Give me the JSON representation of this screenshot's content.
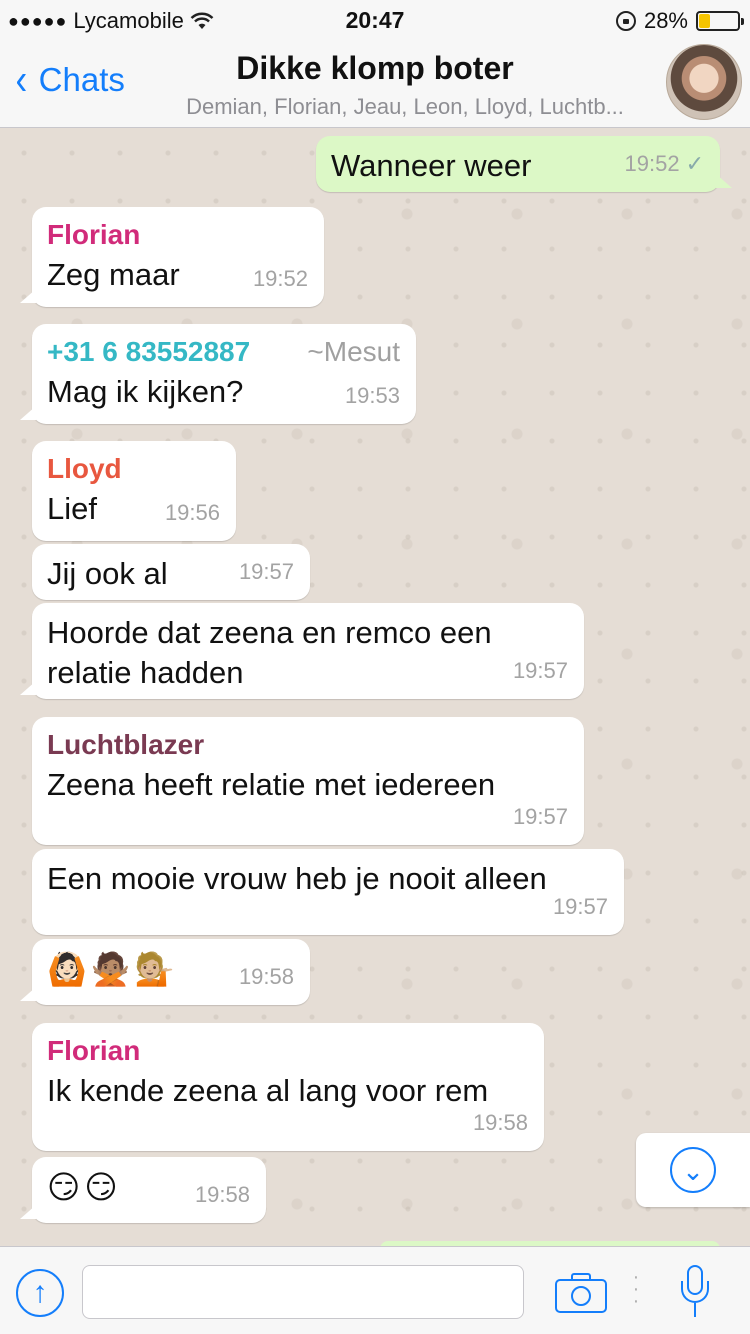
{
  "status_bar": {
    "carrier": "Lycamobile",
    "signal_dots": "●●●●●",
    "wifi": "wifi-icon",
    "time": "20:47",
    "battery_text": "28%",
    "battery_level": 0.28
  },
  "header": {
    "back_label": "Chats",
    "title": "Dikke klomp boter",
    "subtitle": "Demian, Florian, Jeau, Leon, Lloyd, Luchtb..."
  },
  "colors": {
    "accent": "#147efb",
    "outgoing_bubble": "#dcf8c6",
    "florian": "#d12b7a",
    "lloyd": "#e8573f",
    "luchtblazer": "#7a3a52",
    "phone": "#35b8c5"
  },
  "messages": [
    {
      "id": "m1",
      "text": "Wanneer weer",
      "time": "19:52",
      "status": "✓",
      "direction": "out"
    },
    {
      "id": "m2",
      "sender": "Florian",
      "text": "Zeg maar",
      "time": "19:52"
    },
    {
      "id": "m3",
      "phone": "+31 6 83552887",
      "alias": "~Mesut",
      "text": "Mag ik kijken?",
      "time": "19:53"
    },
    {
      "id": "m4",
      "sender": "Lloyd",
      "text": "Lief",
      "time": "19:56"
    },
    {
      "id": "m5",
      "text": "Jij ook al",
      "time": "19:57"
    },
    {
      "id": "m6",
      "text": "Hoorde dat zeena en remco een relatie hadden",
      "time": "19:57"
    },
    {
      "id": "m7",
      "sender": "Luchtblazer",
      "text": "Zeena heeft relatie met iedereen",
      "time": "19:57"
    },
    {
      "id": "m8",
      "text": "Een mooie vrouw heb je nooit alleen",
      "time": "19:57"
    },
    {
      "id": "m9",
      "text": "🙆🏻🙅🏽💁🏼",
      "time": "19:58"
    },
    {
      "id": "m10",
      "sender": "Florian",
      "text": "Ik kende zeena al lang voor rem",
      "time": "19:58"
    },
    {
      "id": "m11",
      "text": "😏😏",
      "time": "19:58"
    }
  ],
  "input_bar": {
    "placeholder": "",
    "upload_icon": "arrow-up-circle-icon",
    "camera_icon": "camera-icon",
    "mic_icon": "microphone-icon"
  }
}
